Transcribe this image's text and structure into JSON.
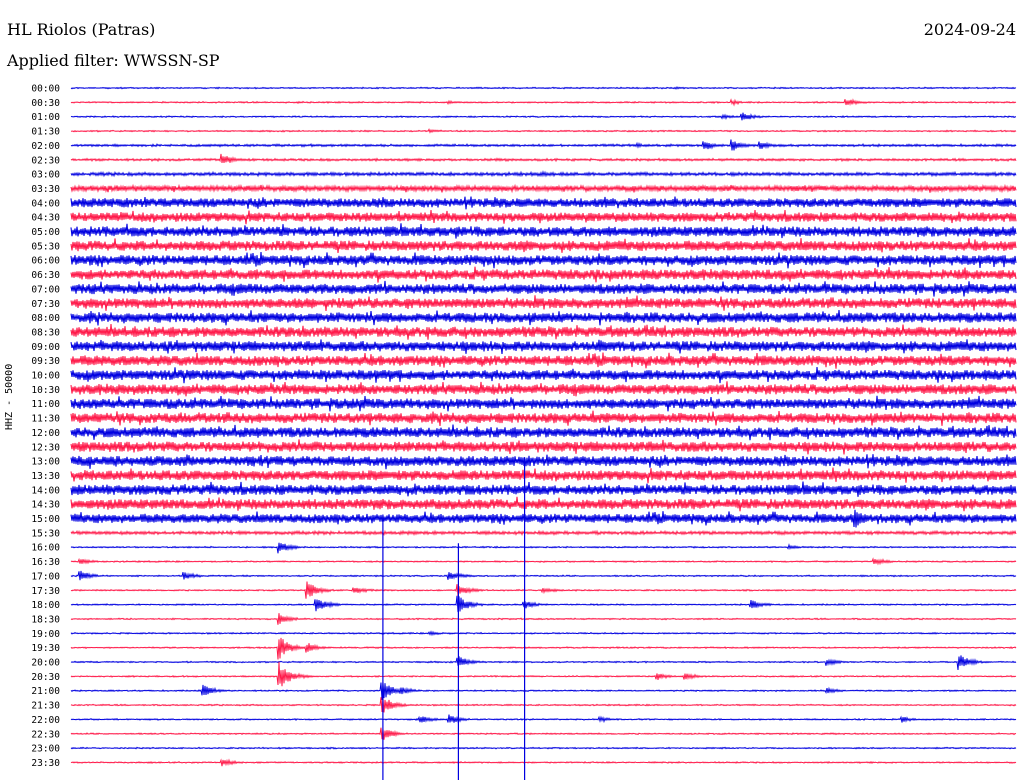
{
  "header": {
    "station": "HL Riolos (Patras)",
    "date": "2024-09-24",
    "filter": "Applied filter: WWSSN-SP"
  },
  "chart_data": {
    "type": "line",
    "title": "HL Riolos (Patras)",
    "ylabel": "HHZ - 50000",
    "xlabel": "",
    "colors": {
      "even_rows": "#0000e0",
      "odd_rows": "#ff1a4a"
    },
    "rows": [
      {
        "label": "00:00",
        "noise": 1,
        "events": [
          [
            0.43,
            2
          ],
          [
            0.64,
            2
          ]
        ]
      },
      {
        "label": "00:30",
        "noise": 1,
        "events": [
          [
            0.24,
            2
          ],
          [
            0.4,
            3
          ],
          [
            0.7,
            5
          ],
          [
            0.82,
            8
          ]
        ]
      },
      {
        "label": "01:00",
        "noise": 1,
        "events": [
          [
            0.71,
            10
          ],
          [
            0.69,
            4
          ]
        ]
      },
      {
        "label": "01:30",
        "noise": 1,
        "events": [
          [
            0.38,
            4
          ]
        ]
      },
      {
        "label": "02:00",
        "noise": 2,
        "events": [
          [
            0.67,
            10
          ],
          [
            0.7,
            12
          ],
          [
            0.73,
            8
          ],
          [
            0.6,
            4
          ]
        ]
      },
      {
        "label": "02:30",
        "noise": 2,
        "events": [
          [
            0.16,
            12
          ],
          [
            0.45,
            3
          ]
        ]
      },
      {
        "label": "03:00",
        "noise": 3,
        "events": [
          [
            0.5,
            4
          ]
        ]
      },
      {
        "label": "03:30",
        "noise": 5,
        "events": []
      },
      {
        "label": "04:00",
        "noise": 9,
        "events": []
      },
      {
        "label": "04:30",
        "noise": 9,
        "events": []
      },
      {
        "label": "05:00",
        "noise": 10,
        "events": []
      },
      {
        "label": "05:30",
        "noise": 10,
        "events": []
      },
      {
        "label": "06:00",
        "noise": 10,
        "events": []
      },
      {
        "label": "06:30",
        "noise": 10,
        "events": []
      },
      {
        "label": "07:00",
        "noise": 10,
        "events": []
      },
      {
        "label": "07:30",
        "noise": 10,
        "events": []
      },
      {
        "label": "08:00",
        "noise": 10,
        "events": []
      },
      {
        "label": "08:30",
        "noise": 10,
        "events": []
      },
      {
        "label": "09:00",
        "noise": 10,
        "events": [
          [
            0.56,
            14
          ]
        ]
      },
      {
        "label": "09:30",
        "noise": 10,
        "events": []
      },
      {
        "label": "10:00",
        "noise": 10,
        "events": []
      },
      {
        "label": "10:30",
        "noise": 10,
        "events": []
      },
      {
        "label": "11:00",
        "noise": 10,
        "events": []
      },
      {
        "label": "11:30",
        "noise": 10,
        "events": []
      },
      {
        "label": "12:00",
        "noise": 10,
        "events": []
      },
      {
        "label": "12:30",
        "noise": 10,
        "events": []
      },
      {
        "label": "13:00",
        "noise": 10,
        "events": []
      },
      {
        "label": "13:30",
        "noise": 10,
        "events": []
      },
      {
        "label": "14:00",
        "noise": 10,
        "events": []
      },
      {
        "label": "14:30",
        "noise": 10,
        "events": []
      },
      {
        "label": "15:00",
        "noise": 9,
        "events": [
          [
            0.83,
            20
          ]
        ]
      },
      {
        "label": "15:30",
        "noise": 3,
        "events": []
      },
      {
        "label": "16:00",
        "noise": 1,
        "events": [
          [
            0.22,
            12
          ],
          [
            0.76,
            4
          ]
        ]
      },
      {
        "label": "16:30",
        "noise": 1,
        "events": [
          [
            0.85,
            8
          ],
          [
            0.01,
            6
          ]
        ]
      },
      {
        "label": "17:00",
        "noise": 1,
        "events": [
          [
            0.01,
            10
          ],
          [
            0.12,
            8
          ],
          [
            0.4,
            10
          ]
        ]
      },
      {
        "label": "17:30",
        "noise": 1,
        "events": [
          [
            0.25,
            18
          ],
          [
            0.3,
            8
          ],
          [
            0.41,
            12
          ],
          [
            0.5,
            6
          ]
        ]
      },
      {
        "label": "18:00",
        "noise": 1,
        "events": [
          [
            0.26,
            14
          ],
          [
            0.41,
            18
          ],
          [
            0.48,
            8
          ],
          [
            0.72,
            10
          ]
        ]
      },
      {
        "label": "18:30",
        "noise": 1,
        "events": [
          [
            0.22,
            12
          ]
        ]
      },
      {
        "label": "19:00",
        "noise": 1,
        "events": [
          [
            0.38,
            4
          ]
        ]
      },
      {
        "label": "19:30",
        "noise": 1,
        "events": [
          [
            0.22,
            25
          ],
          [
            0.25,
            10
          ]
        ]
      },
      {
        "label": "20:00",
        "noise": 1,
        "events": [
          [
            0.41,
            12
          ],
          [
            0.8,
            8
          ],
          [
            0.94,
            16
          ]
        ]
      },
      {
        "label": "20:30",
        "noise": 1,
        "events": [
          [
            0.22,
            30
          ],
          [
            0.62,
            8
          ],
          [
            0.65,
            8
          ]
        ]
      },
      {
        "label": "21:00",
        "noise": 1,
        "events": [
          [
            0.14,
            12
          ],
          [
            0.33,
            20
          ],
          [
            0.35,
            8
          ],
          [
            0.8,
            6
          ]
        ]
      },
      {
        "label": "21:30",
        "noise": 1,
        "events": [
          [
            0.33,
            18
          ]
        ]
      },
      {
        "label": "22:00",
        "noise": 1,
        "events": [
          [
            0.37,
            8
          ],
          [
            0.4,
            10
          ],
          [
            0.56,
            5
          ],
          [
            0.88,
            6
          ]
        ]
      },
      {
        "label": "22:30",
        "noise": 1,
        "events": [
          [
            0.33,
            14
          ]
        ]
      },
      {
        "label": "23:00",
        "noise": 1,
        "events": []
      },
      {
        "label": "23:30",
        "noise": 1,
        "events": [
          [
            0.16,
            8
          ]
        ]
      }
    ],
    "vertical_spikes": [
      {
        "x": 0.33,
        "from_row": 30,
        "to_row": 47
      },
      {
        "x": 0.41,
        "from_row": 32,
        "to_row": 47
      },
      {
        "x": 0.48,
        "from_row": 26,
        "to_row": 47
      }
    ]
  }
}
